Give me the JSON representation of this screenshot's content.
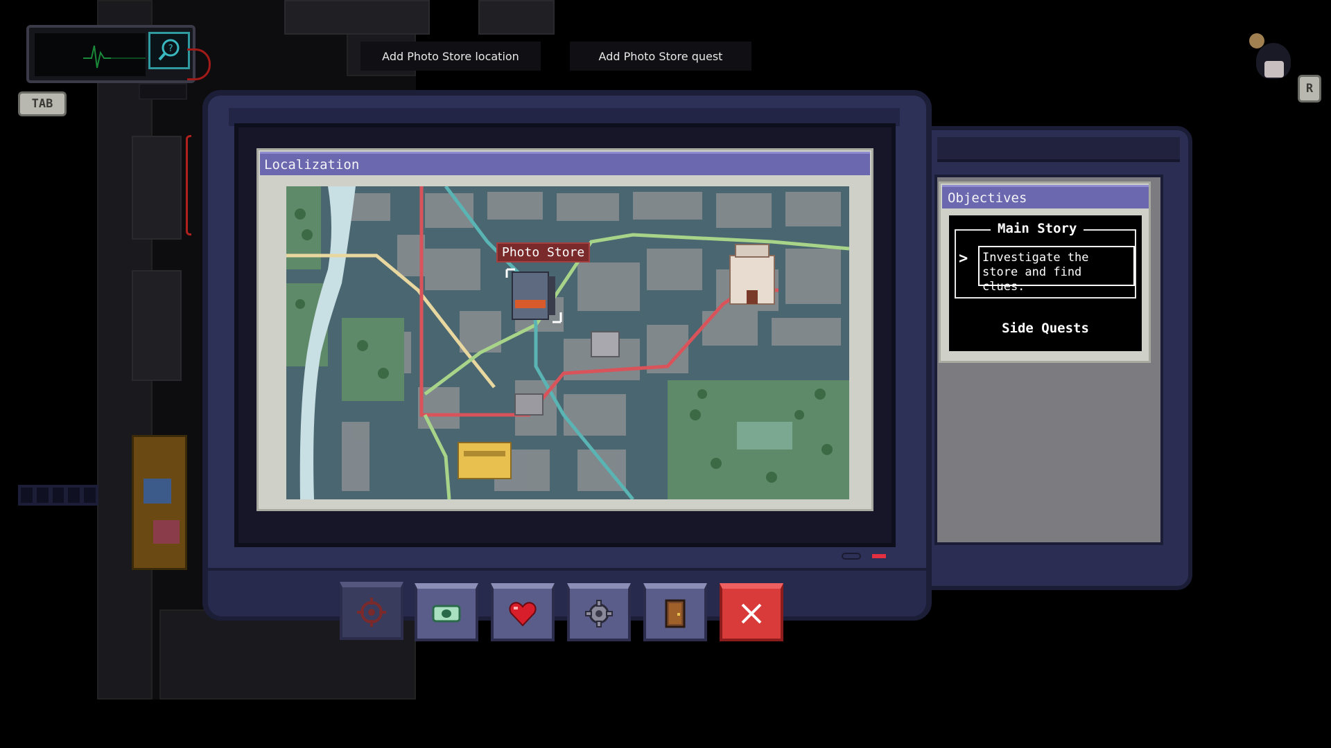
{
  "hud": {
    "tab_key": "TAB",
    "r_key": "R",
    "magnifier_icon": "magnifier-icon",
    "heartbeat_icon": "ecg-line-icon"
  },
  "notifications": [
    "Add Photo Store location",
    "Add Photo Store quest"
  ],
  "map_window": {
    "title": "Localization",
    "marker_label": "Photo Store"
  },
  "objectives": {
    "title": "Objectives",
    "main_story_heading": "Main Story",
    "quests": [
      "Investigate the store and find clues."
    ],
    "side_quests_heading": "Side Quests"
  },
  "toolbar": [
    {
      "icon": "crosshair-icon",
      "active": true
    },
    {
      "icon": "cash-icon",
      "active": false
    },
    {
      "icon": "heart-icon",
      "active": false
    },
    {
      "icon": "gear-icon",
      "active": false
    },
    {
      "icon": "door-icon",
      "active": false
    },
    {
      "icon": "close-icon",
      "active": false
    }
  ],
  "colors": {
    "device_body": "#2e3157",
    "title_bar": "#6b68b0",
    "window_bg": "#cfd0c8",
    "close_red": "#d93a3a",
    "led_red": "#e23040",
    "route_red": "#d9545a",
    "route_teal": "#5ab4b4",
    "route_green": "#a8d48a",
    "route_yellow": "#e8d8a0",
    "river": "#c8dfe4"
  }
}
